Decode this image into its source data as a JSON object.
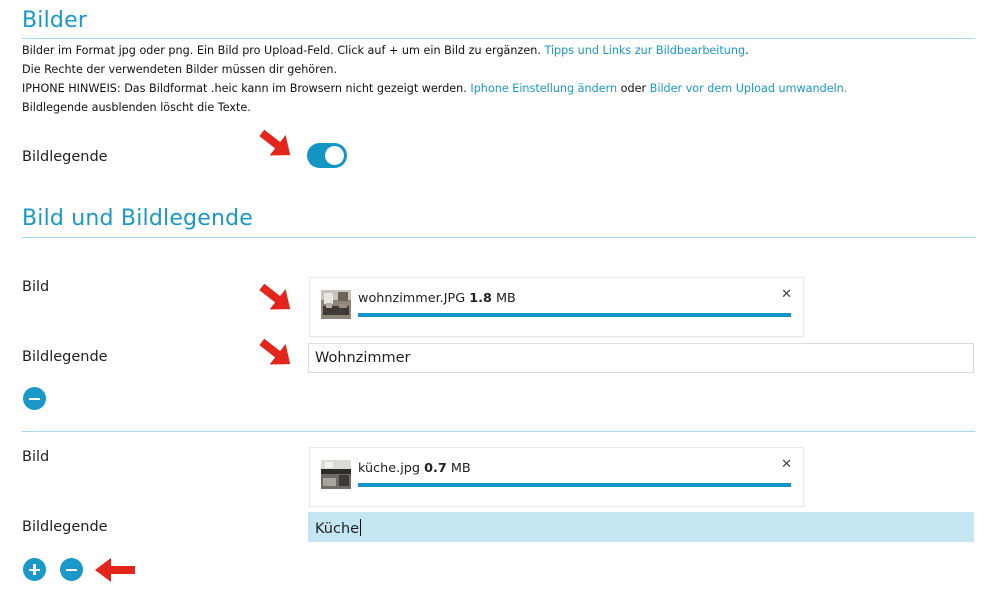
{
  "section1": {
    "title": "Bilder",
    "line1_prefix": "Bilder im Format jpg oder png. Ein Bild pro Upload-Feld. Click auf + um ein Bild zu ergänzen. ",
    "line1_link": "Tipps und Links zur Bildbearbeitung",
    "line1_suffix": ".",
    "line2": "Die Rechte der verwendeten Bilder müssen dir gehören.",
    "line3_prefix": "IPHONE HINWEIS: Das Bildformat .heic kann im Browsern nicht gezeigt werden. ",
    "line3_link1": "Iphone Einstellung ändern",
    "line3_mid": " oder ",
    "line3_link2": "Bilder vor dem Upload umwandeln.",
    "line4": "Bildlegende ausblenden löscht die Texte.",
    "toggle_label": "Bildlegende",
    "toggle_on": true
  },
  "section2": {
    "title": "Bild und Bildlegende",
    "entries": [
      {
        "image_label": "Bild",
        "file_name": "wohnzimmer.JPG",
        "file_size": "1.8",
        "file_unit": "MB",
        "upload_progress": 1.0,
        "caption_label": "Bildlegende",
        "caption_value": "Wohnzimmer"
      },
      {
        "image_label": "Bild",
        "file_name": "küche.jpg",
        "file_size": "0.7",
        "file_unit": "MB",
        "upload_progress": 1.0,
        "caption_label": "Bildlegende",
        "caption_value": "Küche"
      }
    ],
    "remove_icon": "minus-circle-icon",
    "add_icon": "plus-circle-icon",
    "close_icon": "close-icon"
  },
  "colors": {
    "accent": "#1a98c8",
    "arrow": "#e3251b",
    "focused_input": "#c4e5f2"
  }
}
